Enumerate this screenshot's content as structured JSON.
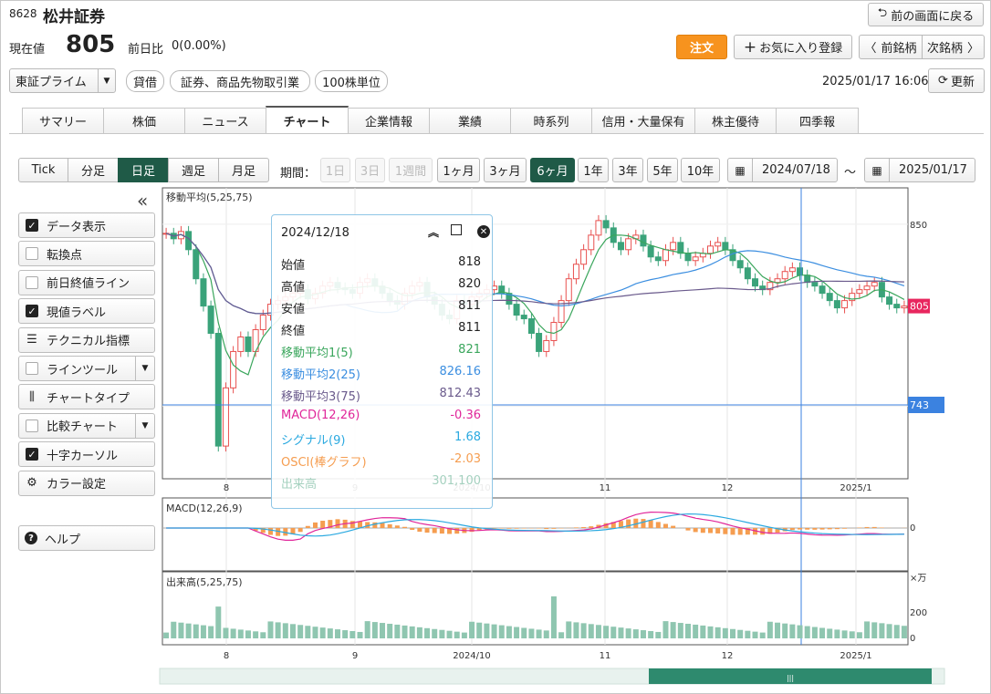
{
  "header": {
    "code": "8628",
    "name": "松井証券",
    "back_label": "前の画面に戻る"
  },
  "price": {
    "label": "現在値",
    "value": "805",
    "change_label": "前日比",
    "change": "0(0.00%)"
  },
  "actions": {
    "order": "注文",
    "favorite": "お気に入り登録",
    "prev": "前銘柄",
    "next": "次銘柄"
  },
  "market": {
    "selected": "東証プライム",
    "tags": [
      "貸借",
      "証券、商品先物取引業",
      "100株単位"
    ],
    "datetime": "2025/01/17 16:06",
    "refresh": "更新"
  },
  "tabs": [
    "サマリー",
    "株価",
    "ニュース",
    "チャート",
    "企業情報",
    "業績",
    "時系列",
    "信用・大量保有",
    "株主優待",
    "四季報"
  ],
  "active_tab": "チャート",
  "intervals": [
    "Tick",
    "分足",
    "日足",
    "週足",
    "月足"
  ],
  "period": {
    "label": "期間：",
    "options": [
      "1日",
      "3日",
      "1週間",
      "1ヶ月",
      "3ヶ月",
      "6ヶ月",
      "1年",
      "3年",
      "5年",
      "10年"
    ],
    "disabled": [
      "1日",
      "3日",
      "1週間"
    ],
    "selected": "6ヶ月",
    "from": "2024/07/18",
    "sep": "〜",
    "to": "2025/01/17"
  },
  "sidebar": {
    "items": [
      {
        "label": "データ表示",
        "kind": "check",
        "checked": true
      },
      {
        "label": "転換点",
        "kind": "check",
        "checked": false
      },
      {
        "label": "前日終値ライン",
        "kind": "check",
        "checked": false
      },
      {
        "label": "現値ラベル",
        "kind": "check",
        "checked": true
      },
      {
        "label": "テクニカル指標",
        "kind": "icon",
        "icon": "sliders-icon"
      },
      {
        "label": "ラインツール",
        "kind": "check",
        "checked": false,
        "dropdown": true
      },
      {
        "label": "チャートタイプ",
        "kind": "icon",
        "icon": "candlestick-icon"
      },
      {
        "label": "比較チャート",
        "kind": "check",
        "checked": false,
        "dropdown": true
      },
      {
        "label": "十字カーソル",
        "kind": "check",
        "checked": true
      },
      {
        "label": "カラー設定",
        "kind": "icon",
        "icon": "gear-icon"
      }
    ],
    "help": "ヘルプ",
    "collapse": "«"
  },
  "chart_data": {
    "type": "candlestick",
    "main_label": "移動平均(5,25,75)",
    "macd_label": "MACD(12,26,9)",
    "volume_label": "出来高(5,25,75)",
    "volume_unit": "×万",
    "x_ticks": [
      "8",
      "9",
      "2024/10",
      "11",
      "12",
      "2025/1"
    ],
    "price_ticks": [
      "850",
      "750"
    ],
    "macd_ticks": [
      "0"
    ],
    "volume_ticks": [
      "200",
      "0"
    ],
    "current_price_label": "805",
    "cursor_price_label": "743",
    "colors": {
      "up": "#e8504f",
      "down": "#3aa37a",
      "ma1": "#3aa65c",
      "ma2": "#3b8ee0",
      "ma3": "#6a5a8c",
      "macd": "#e0269a",
      "signal": "#2aa9e0",
      "osci": "#f59d50",
      "volume": "#8fc6b0",
      "current": "#e8265e",
      "cursor": "#3b82e0"
    },
    "closes": [
      845,
      842,
      846,
      836,
      820,
      805,
      790,
      728,
      760,
      780,
      788,
      780,
      792,
      800,
      806,
      808,
      810,
      812,
      814,
      809,
      812,
      816,
      818,
      815,
      814,
      812,
      818,
      820,
      816,
      812,
      808,
      806,
      812,
      816,
      818,
      810,
      806,
      800,
      798,
      808,
      806,
      810,
      812,
      814,
      816,
      812,
      806,
      800,
      798,
      790,
      780,
      786,
      796,
      808,
      820,
      828,
      836,
      844,
      852,
      848,
      840,
      836,
      842,
      844,
      838,
      832,
      830,
      836,
      840,
      834,
      830,
      832,
      834,
      838,
      840,
      836,
      830,
      826,
      820,
      816,
      814,
      818,
      820,
      824,
      826,
      822,
      818,
      816,
      812,
      808,
      804,
      808,
      812,
      814,
      816,
      818,
      810,
      806,
      804,
      805
    ]
  },
  "tooltip": {
    "date": "2024/12/18",
    "rows": [
      {
        "label": "始値",
        "value": "818"
      },
      {
        "label": "高値",
        "value": "820"
      },
      {
        "label": "安値",
        "value": "811"
      },
      {
        "label": "終値",
        "value": "811"
      },
      {
        "label": "移動平均1(5)",
        "value": "821",
        "color": "#3aa65c"
      },
      {
        "label": "移動平均2(25)",
        "value": "826.16",
        "color": "#3b8ee0"
      },
      {
        "label": "移動平均3(75)",
        "value": "812.43",
        "color": "#6a5a8c"
      },
      {
        "label": "MACD(12,26)",
        "value": "-0.36",
        "color": "#e0269a"
      },
      {
        "label": "シグナル(9)",
        "value": "1.68",
        "color": "#2aa9e0"
      },
      {
        "label": "OSCI(棒グラフ)",
        "value": "-2.03",
        "color": "#f59d50"
      },
      {
        "label": "出来高",
        "value": "301,100",
        "color": "#8fc6b0"
      }
    ]
  }
}
